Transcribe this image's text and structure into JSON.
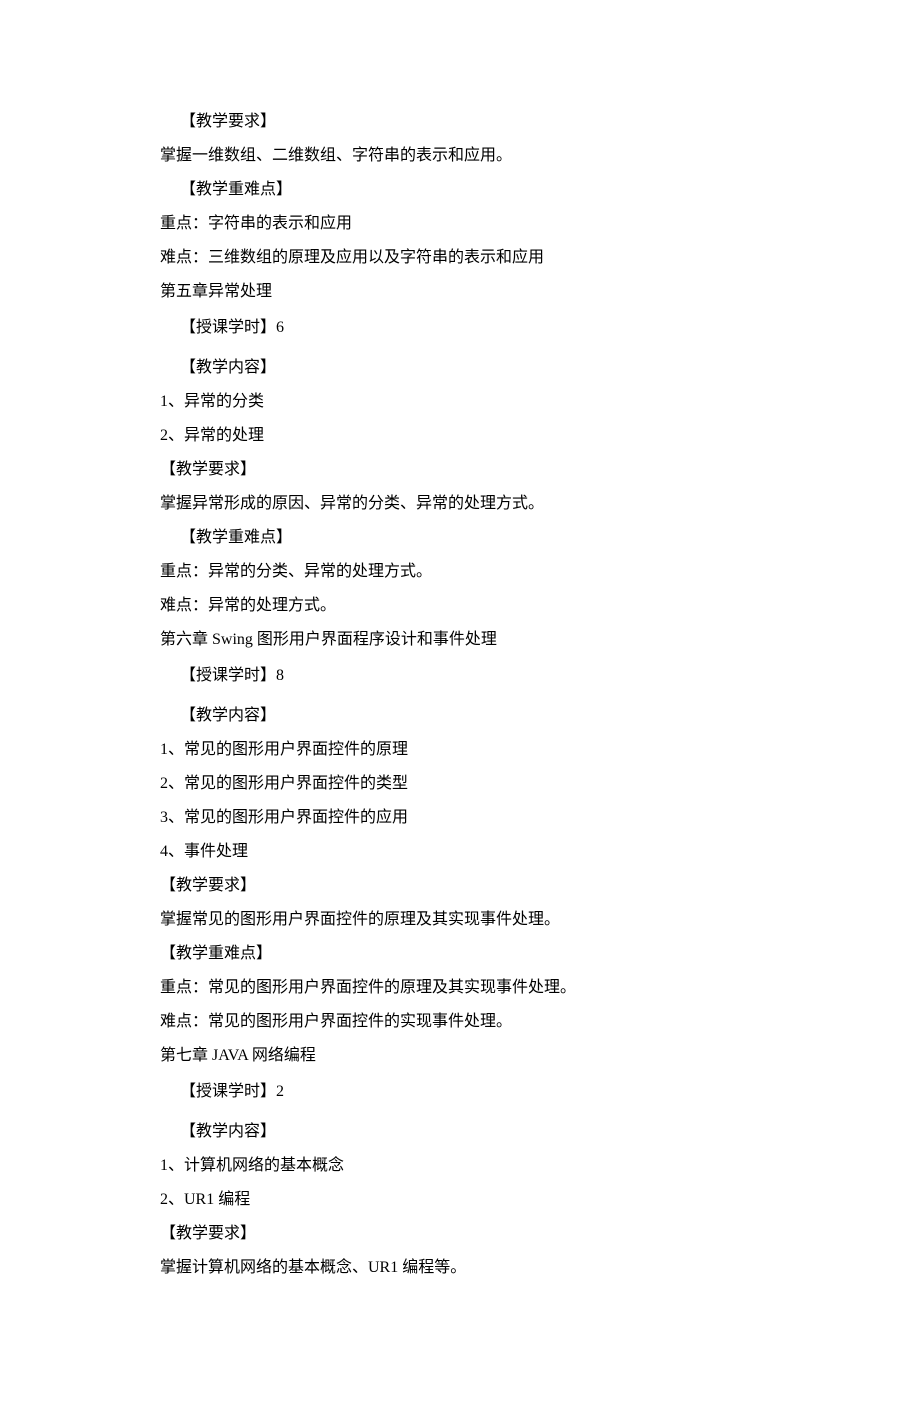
{
  "lines": [
    {
      "text": "【教学要求】",
      "cls": "indent-1"
    },
    {
      "text": "掌握一维数组、二维数组、字符串的表示和应用。",
      "cls": "indent-0"
    },
    {
      "text": "【教学重难点】",
      "cls": "indent-1"
    },
    {
      "text": "重点：字符串的表示和应用",
      "cls": "indent-0"
    },
    {
      "text": "难点：三维数组的原理及应用以及字符串的表示和应用",
      "cls": "indent-0"
    },
    {
      "text": "第五章异常处理",
      "cls": "indent-0 chapter"
    },
    {
      "text": "【授课学时】6",
      "cls": "indent-1"
    },
    {
      "text": "",
      "cls": "spacer"
    },
    {
      "text": "【教学内容】",
      "cls": "indent-1"
    },
    {
      "text": "1、异常的分类",
      "cls": "indent-0"
    },
    {
      "text": "2、异常的处理",
      "cls": "indent-0"
    },
    {
      "text": "【教学要求】",
      "cls": "indent-0"
    },
    {
      "text": "掌握异常形成的原因、异常的分类、异常的处理方式。",
      "cls": "indent-0"
    },
    {
      "text": "【教学重难点】",
      "cls": "indent-1"
    },
    {
      "text": "重点：异常的分类、异常的处理方式。",
      "cls": "indent-0"
    },
    {
      "text": "难点：异常的处理方式。",
      "cls": "indent-0"
    },
    {
      "text": "第六章 Swing 图形用户界面程序设计和事件处理",
      "cls": "indent-0 chapter"
    },
    {
      "text": "【授课学时】8",
      "cls": "indent-1"
    },
    {
      "text": "",
      "cls": "spacer"
    },
    {
      "text": "【教学内容】",
      "cls": "indent-1"
    },
    {
      "text": "1、常见的图形用户界面控件的原理",
      "cls": "indent-0"
    },
    {
      "text": "2、常见的图形用户界面控件的类型",
      "cls": "indent-0"
    },
    {
      "text": "3、常见的图形用户界面控件的应用",
      "cls": "indent-0"
    },
    {
      "text": "4、事件处理",
      "cls": "indent-0"
    },
    {
      "text": "【教学要求】",
      "cls": "indent-0"
    },
    {
      "text": "掌握常见的图形用户界面控件的原理及其实现事件处理。",
      "cls": "indent-0"
    },
    {
      "text": "【教学重难点】",
      "cls": "indent-0"
    },
    {
      "text": "重点：常见的图形用户界面控件的原理及其实现事件处理。",
      "cls": "indent-0"
    },
    {
      "text": "难点：常见的图形用户界面控件的实现事件处理。",
      "cls": "indent-0"
    },
    {
      "text": "第七章 JAVA 网络编程",
      "cls": "indent-0 chapter"
    },
    {
      "text": "【授课学时】2",
      "cls": "indent-1"
    },
    {
      "text": "",
      "cls": "spacer"
    },
    {
      "text": "【教学内容】",
      "cls": "indent-1"
    },
    {
      "text": "1、计算机网络的基本概念",
      "cls": "indent-0"
    },
    {
      "text": "2、UR1 编程",
      "cls": "indent-0"
    },
    {
      "text": "【教学要求】",
      "cls": "indent-0"
    },
    {
      "text": "掌握计算机网络的基本概念、UR1 编程等。",
      "cls": "indent-0"
    }
  ]
}
